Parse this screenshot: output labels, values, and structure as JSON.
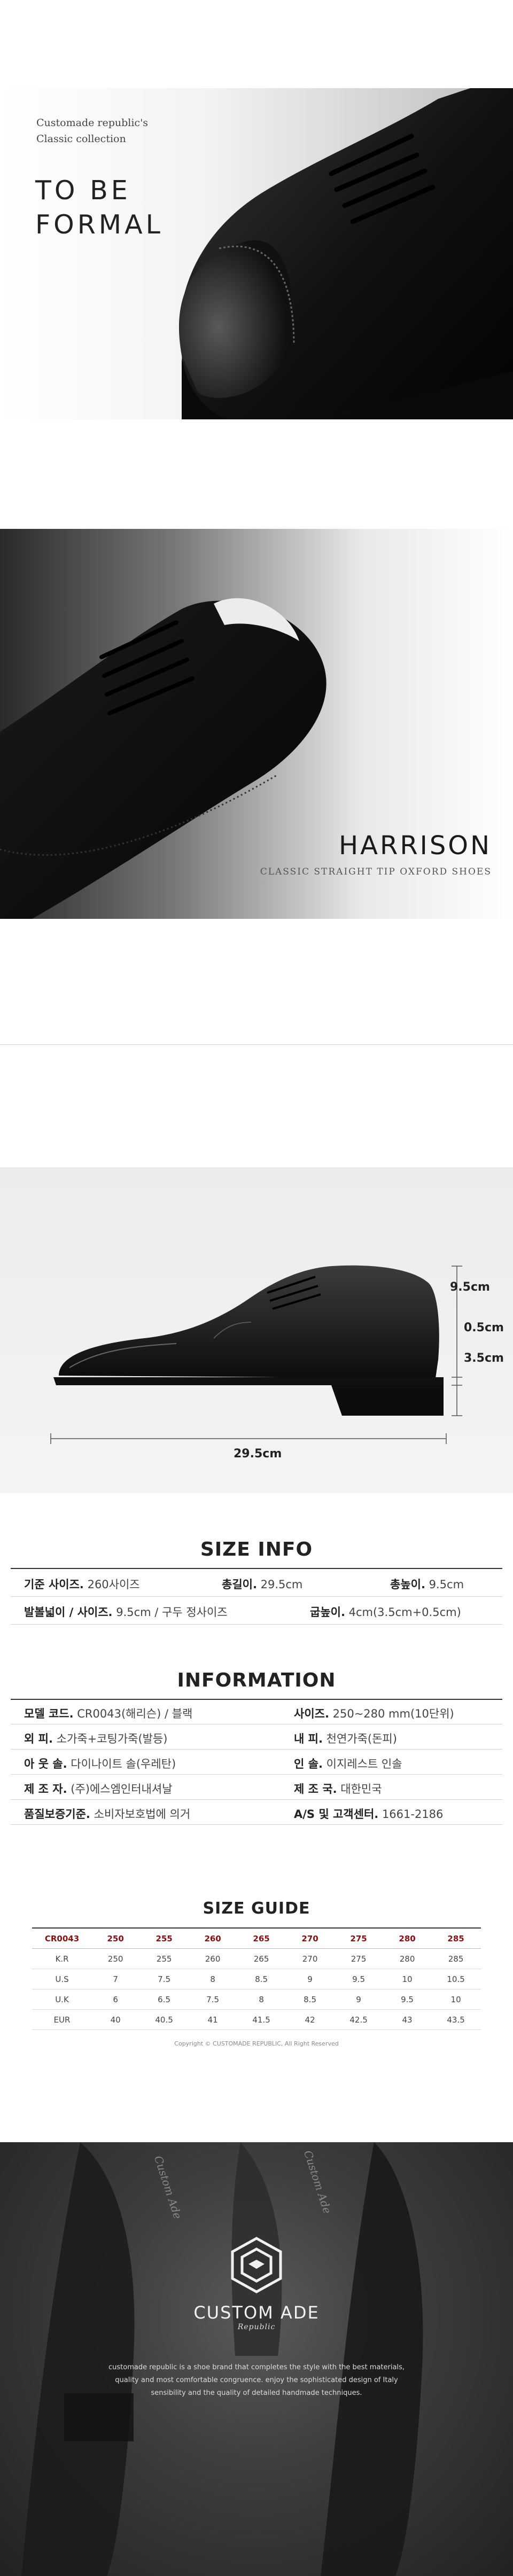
{
  "hero": {
    "tagline_line1": "Customade republic's",
    "tagline_line2": "Classic collection",
    "headline_line1": "TO BE",
    "headline_line2": "FORMAL"
  },
  "harrison": {
    "name": "HARRISON",
    "subtitle": "CLASSIC STRAIGHT TIP OXFORD SHOES"
  },
  "measurement": {
    "height_total": "9.5cm",
    "sole": "0.5cm",
    "heel": "3.5cm",
    "length": "29.5cm"
  },
  "size_info": {
    "title": "SIZE INFO",
    "rows": [
      [
        {
          "label": "기준 사이즈.",
          "value": "260사이즈"
        },
        {
          "label": "총길이.",
          "value": "29.5cm"
        },
        {
          "label": "총높이.",
          "value": "9.5cm"
        }
      ],
      [
        {
          "label": "발볼넓이 / 사이즈.",
          "value": "9.5cm / 구두 정사이즈"
        },
        {
          "label": "굽높이.",
          "value": "4cm(3.5cm+0.5cm)"
        }
      ]
    ]
  },
  "information": {
    "title": "INFORMATION",
    "rows": [
      [
        {
          "label": "모델 코드.",
          "value": "CR0043(해리슨) / 블랙"
        },
        {
          "label": "사이즈.",
          "value": "250~280 mm(10단위)"
        }
      ],
      [
        {
          "label": "외    피.",
          "value": "소가죽+코팅가죽(발등)"
        },
        {
          "label": "내    피.",
          "value": "천연가죽(돈피)"
        }
      ],
      [
        {
          "label": "아 웃 솔.",
          "value": "다이나이트 솔(우레탄)"
        },
        {
          "label": "인    솔.",
          "value": "이지레스트 인솔"
        }
      ],
      [
        {
          "label": "제 조 자.",
          "value": "(주)에스엠인터내셔날"
        },
        {
          "label": "제 조 국.",
          "value": "대한민국"
        }
      ],
      [
        {
          "label": "품질보증기준.",
          "value": "소비자보호법에 의거"
        },
        {
          "label": "A/S 및 고객센터.",
          "value": "1661-2186"
        }
      ]
    ]
  },
  "size_guide": {
    "title": "SIZE GUIDE",
    "header": [
      "CR0043",
      "250",
      "255",
      "260",
      "265",
      "270",
      "275",
      "280",
      "285"
    ],
    "rows": [
      [
        "K.R",
        "250",
        "255",
        "260",
        "265",
        "270",
        "275",
        "280",
        "285"
      ],
      [
        "U.S",
        "7",
        "7.5",
        "8",
        "8.5",
        "9",
        "9.5",
        "10",
        "10.5"
      ],
      [
        "U.K",
        "6",
        "6.5",
        "7.5",
        "8",
        "8.5",
        "9",
        "9.5",
        "10"
      ],
      [
        "EUR",
        "40",
        "40.5",
        "41",
        "41.5",
        "42",
        "42.5",
        "43",
        "43.5"
      ]
    ],
    "copyright": "Copyright © CUSTOMADE REPUBLIC, All Right Reserved"
  },
  "brand": {
    "name": "CUSTOM ADE",
    "script": "Republic",
    "description_line1": "customade republic is a shoe brand that completes the style with the best materials,",
    "description_line2": "quality and most comfortable congruence. enjoy the sophisticated design of Italy",
    "description_line3": "sensibility and the quality of detailed handmade techniques.",
    "insole_text": "Custom Ade"
  },
  "colors": {
    "accent_red": "#8b0f0f",
    "dark_bg": "#3a3a3a"
  }
}
